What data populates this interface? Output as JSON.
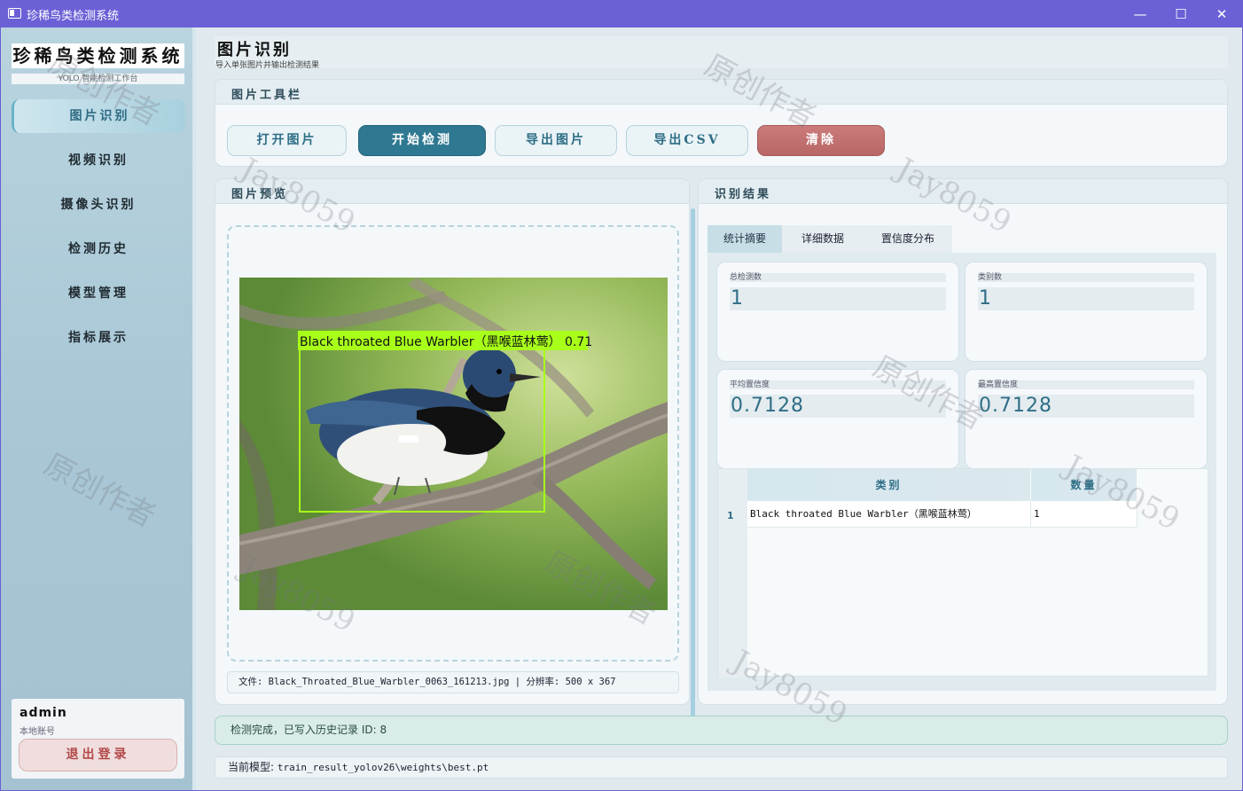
{
  "window": {
    "title": "珍稀鸟类检测系统",
    "controls": {
      "minimize": "—",
      "maximize": "☐",
      "close": "✕"
    }
  },
  "sidebar": {
    "app_title": "珍稀鸟类检测系统",
    "app_subtitle": "YOLO 智能检测工作台",
    "items": [
      {
        "label": "图片识别",
        "active": true
      },
      {
        "label": "视频识别"
      },
      {
        "label": "摄像头识别"
      },
      {
        "label": "检测历史"
      },
      {
        "label": "模型管理"
      },
      {
        "label": "指标展示"
      }
    ],
    "user": {
      "name": "admin",
      "role": "本地账号",
      "logout_label": "退出登录"
    }
  },
  "header": {
    "title": "图片识别",
    "subtitle": "导入单张图片并输出检测结果"
  },
  "toolbar": {
    "title": "图片工具栏",
    "buttons": {
      "open": "打开图片",
      "detect": "开始检测",
      "export_image": "导出图片",
      "export_csv": "导出CSV",
      "clear": "清除"
    }
  },
  "preview": {
    "title": "图片预览",
    "detection_label": "Black throated Blue Warbler（黑喉蓝林莺） 0.71",
    "file_info": "文件: Black_Throated_Blue_Warbler_0063_161213.jpg | 分辨率: 500 x 367"
  },
  "results": {
    "title": "识别结果",
    "tabs": [
      "统计摘要",
      "详细数据",
      "置信度分布"
    ],
    "stats": {
      "total_label": "总检测数",
      "total_value": "1",
      "classes_label": "类别数",
      "classes_value": "1",
      "avg_label": "平均置信度",
      "avg_value": "0.7128",
      "max_label": "最高置信度",
      "max_value": "0.7128"
    },
    "table": {
      "headers": [
        "类别",
        "数量"
      ],
      "rows": [
        {
          "index": "1",
          "class": "Black throated Blue Warbler（黑喉蓝林莺）",
          "count": "1"
        }
      ]
    }
  },
  "status": {
    "message": "检测完成，已写入历史记录 ID: 8"
  },
  "model": {
    "label": "当前模型:",
    "path": "train_result_yolov26\\weights\\best.pt"
  },
  "watermarks": {
    "a": "原创作者",
    "b": "Jay8059"
  },
  "colors": {
    "accent": "#2f7891",
    "titlebar": "#6b60d6",
    "danger": "#b86666",
    "bbox": "#a8ff1a"
  }
}
